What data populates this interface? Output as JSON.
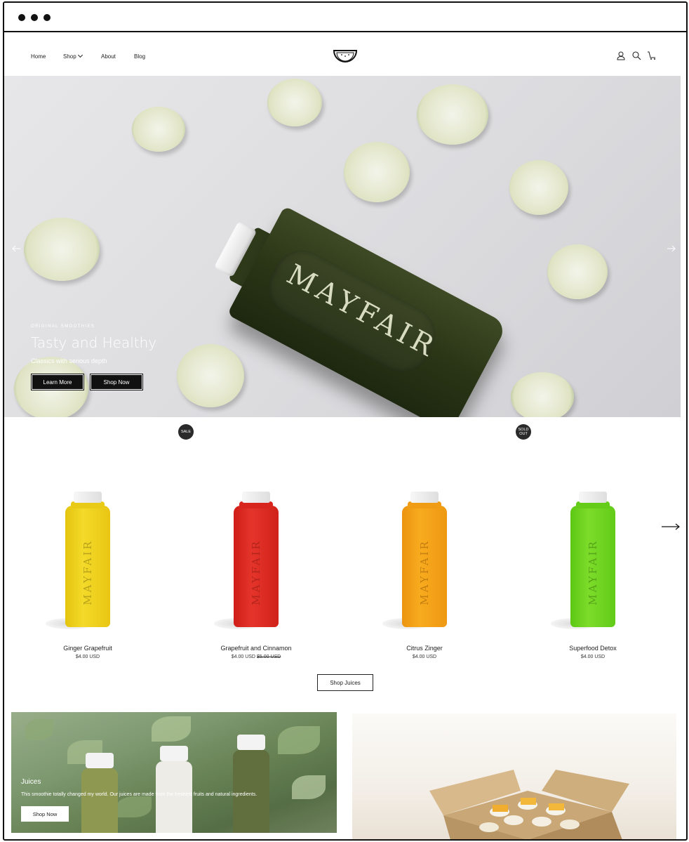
{
  "nav": {
    "links": [
      "Home",
      "Shop",
      "About",
      "Blog"
    ]
  },
  "hero": {
    "bottle_word": "MAYFAIR",
    "eyebrow": "ORIGINAL SMOOTHIES",
    "title": "Tasty and Healthy",
    "subtitle": "Classics with serious depth",
    "buttons": [
      "Learn More",
      "Shop Now"
    ]
  },
  "products": {
    "items": [
      {
        "name": "Ginger Grapefruit",
        "price": "$4.00 USD",
        "was": "",
        "badge": "",
        "color": "#f2d21a",
        "word": "MAYFAIR"
      },
      {
        "name": "Grapefruit and Cinnamon",
        "price": "$4.00 USD",
        "was": "$5.00 USD",
        "badge": "SALE",
        "color": "#e2261f",
        "word": "MAYFAIR"
      },
      {
        "name": "Citrus Zinger",
        "price": "$4.00 USD",
        "was": "",
        "badge": "",
        "color": "#f6a414",
        "word": "MAYFAIR"
      },
      {
        "name": "Superfood Detox",
        "price": "$4.00 USD",
        "was": "",
        "badge": "SOLD OUT",
        "color": "#6ed61f",
        "word": "MAYFAIR"
      }
    ],
    "badges": {
      "sale": "SALE",
      "sold_out": "SOLD OUT"
    },
    "shop_button": "Shop Juices"
  },
  "collections": {
    "left": {
      "title": "Juices",
      "text": "This smoothie totally changed my world. Our juices are made from the freshest fruits and natural ingredients.",
      "button": "Shop Now"
    }
  },
  "icons": {
    "account": "user-icon",
    "search": "search-icon",
    "cart": "cart-icon",
    "logo": "watermelon-logo-icon"
  }
}
